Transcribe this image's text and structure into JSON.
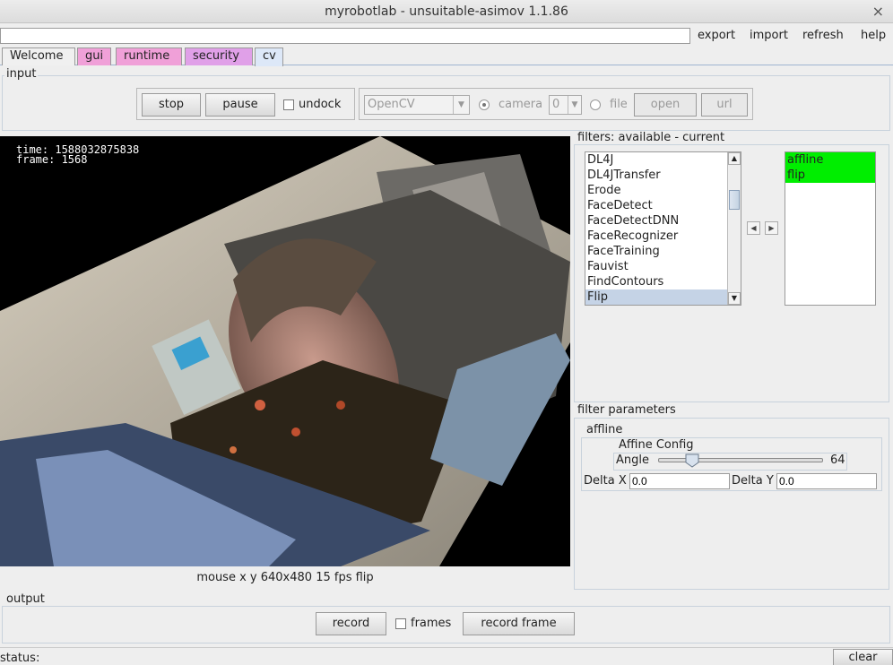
{
  "window": {
    "title": "myrobotlab - unsuitable-asimov 1.1.86",
    "close_glyph": "×"
  },
  "menubar": {
    "command_value": "",
    "items": [
      "export",
      "import",
      "refresh",
      "help"
    ]
  },
  "tabs": [
    {
      "label": "Welcome",
      "color": "#f0f0f0"
    },
    {
      "label": "gui",
      "color": "#f0a0d8"
    },
    {
      "label": "runtime",
      "color": "#f0a0d8"
    },
    {
      "label": "security",
      "color": "#e0a0e8"
    },
    {
      "label": "cv",
      "color": "#dde8f8",
      "selected": true
    }
  ],
  "input": {
    "title": "input",
    "stop_label": "stop",
    "pause_label": "pause",
    "undock_label": "undock",
    "undock_checked": false,
    "framegrabber_value": "OpenCV",
    "camera_label": "camera",
    "camera_selected": true,
    "camera_index": "0",
    "file_label": "file",
    "file_selected": false,
    "open_label": "open",
    "url_label": "url"
  },
  "video": {
    "time_text": "time:  1588032875838",
    "frame_text": "frame: 1568",
    "status_text": "mouse x y  640x480 15 fps flip"
  },
  "filters": {
    "title": "filters: available - current",
    "available": [
      "DL4J",
      "DL4JTransfer",
      "Erode",
      "FaceDetect",
      "FaceDetectDNN",
      "FaceRecognizer",
      "FaceTraining",
      "Fauvist",
      "FindContours",
      "Flip"
    ],
    "available_selected": "Flip",
    "current": [
      "affline",
      "flip"
    ],
    "current_highlight_color": "#00ee00",
    "selected_item_color": "#c5d3e6"
  },
  "filter_parameters": {
    "title": "filter parameters",
    "filter_name": "affline",
    "config_title": "Affine Config",
    "angle_label": "Angle",
    "angle_value": "64",
    "angle_min": 0,
    "angle_max": 360,
    "delta_x_label": "Delta X",
    "delta_x_value": "0.0",
    "delta_y_label": "Delta Y",
    "delta_y_value": "0.0"
  },
  "output": {
    "title": "output",
    "record_label": "record",
    "frames_label": "frames",
    "frames_checked": false,
    "record_frame_label": "record frame"
  },
  "status": {
    "label": "status:",
    "clear_label": "clear"
  }
}
